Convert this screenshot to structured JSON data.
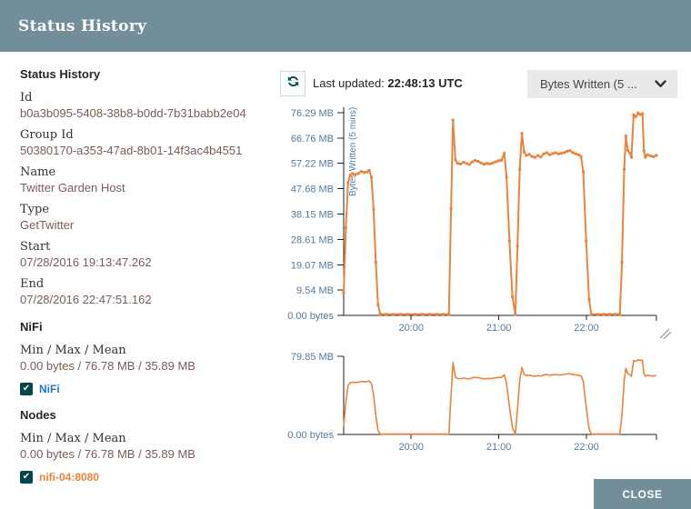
{
  "dialog": {
    "title": "Status History",
    "close_label": "CLOSE"
  },
  "details": {
    "heading": "Status History",
    "fields": [
      {
        "label": "Id",
        "value": "b0a3b095-5408-38b8-b0dd-7b31babb2e04"
      },
      {
        "label": "Group Id",
        "value": "50380170-a353-47ad-8b01-14f3ac4b4551"
      },
      {
        "label": "Name",
        "value": "Twitter Garden Host"
      },
      {
        "label": "Type",
        "value": "GetTwitter"
      },
      {
        "label": "Start",
        "value": "07/28/2016 19:13:47.262"
      },
      {
        "label": "End",
        "value": "07/28/2016 22:47:51.162"
      }
    ],
    "cluster": {
      "heading": "NiFi",
      "stat_label": "Min / Max / Mean",
      "stat_value": "0.00 bytes / 76.78 MB / 35.89 MB",
      "checkbox": {
        "label": "NiFi",
        "checked": true,
        "label_color": "#2573c2"
      }
    },
    "nodes": {
      "heading": "Nodes",
      "stat_label": "Min / Max / Mean",
      "stat_value": "0.00 bytes / 76.78 MB / 35.89 MB",
      "checkbox": {
        "label": "nifi-04:8080",
        "checked": true,
        "label_color": "#e8843c"
      }
    }
  },
  "toolbar": {
    "refresh_icon": "refresh-icon",
    "last_updated_label": "Last updated:",
    "last_updated_value": "22:48:13 UTC",
    "metric_dropdown": {
      "value": "Bytes Written (5 ...",
      "icon": "chevron-down-icon"
    }
  },
  "chart_data": {
    "type": "line",
    "series": [
      {
        "name": "nifi-04:8080",
        "color": "#e8843c",
        "points_t_mb": [
          [
            0,
            8.5
          ],
          [
            1.5,
            33
          ],
          [
            3,
            50
          ],
          [
            4.5,
            52.8
          ],
          [
            6,
            53.4
          ],
          [
            8,
            53.0
          ],
          [
            10,
            53.4
          ],
          [
            12,
            54.2
          ],
          [
            14,
            53.8
          ],
          [
            16,
            54.0
          ],
          [
            17.5,
            54.6
          ],
          [
            19,
            52
          ],
          [
            20.5,
            40
          ],
          [
            22,
            20
          ],
          [
            23.5,
            4
          ],
          [
            25,
            0.4
          ],
          [
            29,
            0.4
          ],
          [
            34,
            0.4
          ],
          [
            39,
            0.4
          ],
          [
            44,
            0.4
          ],
          [
            49,
            0.4
          ],
          [
            54,
            0.4
          ],
          [
            59,
            0.4
          ],
          [
            64,
            0.4
          ],
          [
            68,
            0.4
          ],
          [
            72,
            0.4
          ],
          [
            73.5,
            40
          ],
          [
            74.8,
            73.5
          ],
          [
            76.5,
            58.5
          ],
          [
            78,
            57.2
          ],
          [
            80,
            57.0
          ],
          [
            82,
            57.6
          ],
          [
            84,
            57.2
          ],
          [
            86,
            56.8
          ],
          [
            88,
            57.8
          ],
          [
            90,
            58.3
          ],
          [
            92,
            58.0
          ],
          [
            94,
            57.4
          ],
          [
            96,
            56.9
          ],
          [
            98,
            57.2
          ],
          [
            100,
            57.0
          ],
          [
            102,
            57.4
          ],
          [
            104,
            57.8
          ],
          [
            106,
            58.2
          ],
          [
            108,
            58.4
          ],
          [
            110,
            61.0
          ],
          [
            111.5,
            52
          ],
          [
            113.5,
            28
          ],
          [
            115.5,
            7
          ],
          [
            117.5,
            0.4
          ],
          [
            119,
            26
          ],
          [
            120.5,
            55
          ],
          [
            122,
            68.5
          ],
          [
            123.5,
            61.5
          ],
          [
            125,
            60.2
          ],
          [
            127,
            60.6
          ],
          [
            129,
            59.8
          ],
          [
            131,
            59.5
          ],
          [
            133,
            60.2
          ],
          [
            135,
            59.6
          ],
          [
            137,
            60.8
          ],
          [
            139,
            61.2
          ],
          [
            141,
            60.5
          ],
          [
            143,
            60.9
          ],
          [
            145,
            61.2
          ],
          [
            147,
            60.8
          ],
          [
            149,
            61.0
          ],
          [
            151,
            61.3
          ],
          [
            153,
            61.8
          ],
          [
            155,
            62.0
          ],
          [
            157,
            61.2
          ],
          [
            159,
            60.8
          ],
          [
            161,
            60.4
          ],
          [
            162.5,
            59.8
          ],
          [
            164,
            54
          ],
          [
            166,
            28
          ],
          [
            168,
            6
          ],
          [
            169.5,
            0.4
          ],
          [
            174,
            0.4
          ],
          [
            178,
            0.4
          ],
          [
            182,
            0.4
          ],
          [
            186,
            0.4
          ],
          [
            189,
            0.4
          ],
          [
            190.5,
            20
          ],
          [
            192,
            55
          ],
          [
            193.2,
            67.5
          ],
          [
            194.5,
            62
          ],
          [
            196,
            61
          ],
          [
            197,
            59.5
          ],
          [
            198.5,
            75.5
          ],
          [
            200,
            74.8
          ],
          [
            201.5,
            76.2
          ],
          [
            203,
            75.6
          ],
          [
            204.5,
            75.9
          ],
          [
            205.5,
            62
          ],
          [
            206.5,
            59.5
          ],
          [
            208,
            60.5
          ],
          [
            210,
            60.0
          ],
          [
            212,
            59.7
          ],
          [
            214,
            60.2
          ]
        ]
      }
    ],
    "x_range_minutes": [
      0,
      214.1
    ],
    "x_start": "19:13:47",
    "x_end": "22:47:51",
    "x_ticks": [
      {
        "t": 46.2,
        "label": "20:00"
      },
      {
        "t": 106.2,
        "label": "21:00"
      },
      {
        "t": 166.2,
        "label": "22:00"
      }
    ],
    "main_chart": {
      "ylabel": "Bytes Written (5 mins)",
      "ylim_mb": [
        0,
        76.29
      ],
      "y_ticks": [
        {
          "v": 76.29,
          "label": "76.29 MB"
        },
        {
          "v": 66.76,
          "label": "66.76 MB"
        },
        {
          "v": 57.22,
          "label": "57.22 MB"
        },
        {
          "v": 47.68,
          "label": "47.68 MB"
        },
        {
          "v": 38.15,
          "label": "38.15 MB"
        },
        {
          "v": 28.61,
          "label": "28.61 MB"
        },
        {
          "v": 19.07,
          "label": "19.07 MB"
        },
        {
          "v": 9.54,
          "label": "9.54 MB"
        },
        {
          "v": 0,
          "label": "0.00 bytes"
        }
      ]
    },
    "brush_chart": {
      "ylim_mb": [
        0,
        79.85
      ],
      "y_ticks": [
        {
          "v": 79.85,
          "label": "79.85 MB"
        },
        {
          "v": 0,
          "label": "0.00 bytes"
        }
      ]
    },
    "axis_color": "#222222",
    "tick_label_color": "#557a99",
    "legend_position": "none",
    "grid": false
  }
}
